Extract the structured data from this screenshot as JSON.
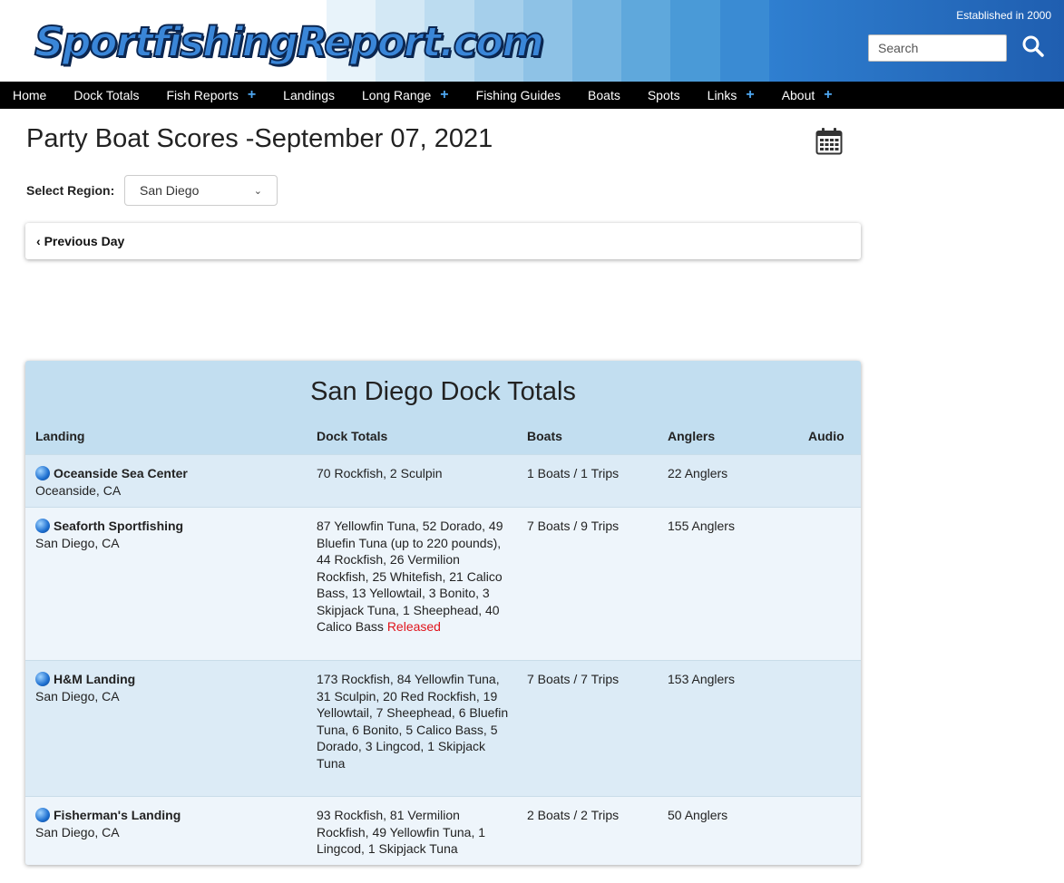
{
  "header": {
    "logo_text": "SportfishingReport.com",
    "established": "Established in 2000",
    "search_placeholder": "Search",
    "search_icon": "search-icon",
    "stripe_colors": [
      "#e8f3fa",
      "#d3e8f5",
      "#bcdcf0",
      "#a5cfeb",
      "#8ec2e6",
      "#76b5e1",
      "#5fa8dc",
      "#4a9ad7",
      "#3a8bd3"
    ]
  },
  "nav": {
    "items": [
      {
        "label": "Home",
        "plus": ""
      },
      {
        "label": "Dock Totals",
        "plus": ""
      },
      {
        "label": "Fish Reports",
        "plus": "+"
      },
      {
        "label": "Landings",
        "plus": ""
      },
      {
        "label": "Long Range",
        "plus": "+"
      },
      {
        "label": "Fishing Guides",
        "plus": ""
      },
      {
        "label": "Boats",
        "plus": ""
      },
      {
        "label": "Spots",
        "plus": ""
      },
      {
        "label": "Links",
        "plus": "+"
      },
      {
        "label": "About",
        "plus": "+"
      }
    ]
  },
  "page": {
    "title": "Party Boat Scores -September 07, 2021",
    "region_label": "Select Region:",
    "region_value": "San Diego",
    "prev_day": "Previous Day",
    "calendar_icon": "calendar-icon"
  },
  "table": {
    "title": "San Diego Dock Totals",
    "headers": {
      "landing": "Landing",
      "totals": "Dock Totals",
      "boats": "Boats",
      "anglers": "Anglers",
      "audio": "Audio"
    },
    "rows": [
      {
        "name": "Oceanside Sea Center",
        "location": "Oceanside, CA",
        "totals": "70 Rockfish, 2 Sculpin",
        "released": "",
        "boats": "1 Boats / 1 Trips",
        "anglers": "22 Anglers"
      },
      {
        "name": "Seaforth Sportfishing",
        "location": "San Diego, CA",
        "totals": "87 Yellowfin Tuna, 52 Dorado, 49 Bluefin Tuna (up to 220 pounds), 44 Rockfish, 26 Vermilion Rockfish, 25 Whitefish, 21 Calico Bass, 13 Yellowtail, 3 Bonito, 3 Skipjack Tuna, 1 Sheephead, 40 Calico Bass",
        "released": "Released",
        "boats": "7 Boats / 9 Trips",
        "anglers": "155 Anglers"
      },
      {
        "name": "H&M Landing",
        "location": "San Diego, CA",
        "totals": "173 Rockfish, 84 Yellowfin Tuna, 31 Sculpin, 20 Red Rockfish, 19 Yellowtail, 7 Sheephead, 6 Bluefin Tuna, 6 Bonito, 5 Calico Bass, 5 Dorado, 3 Lingcod, 1 Skipjack Tuna",
        "released": "",
        "boats": "7 Boats / 7 Trips",
        "anglers": "153 Anglers"
      },
      {
        "name": "Fisherman's Landing",
        "location": "San Diego, CA",
        "totals": "93 Rockfish, 81 Vermilion Rockfish, 49 Yellowfin Tuna, 1 Lingcod, 1 Skipjack Tuna",
        "released": "",
        "boats": "2 Boats / 2 Trips",
        "anglers": "50 Anglers"
      }
    ]
  }
}
